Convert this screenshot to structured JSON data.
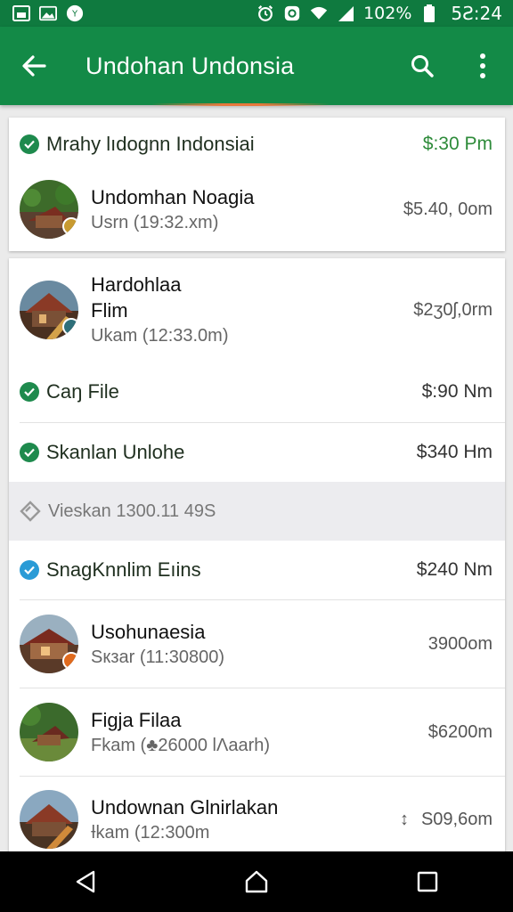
{
  "status_bar": {
    "battery": "102%",
    "time": "5Ƨ:24"
  },
  "app_bar": {
    "title": "Undohan Undonsia"
  },
  "card1": {
    "header": {
      "label": "Mrahy lıdognn Indonsiai",
      "value": "$:30 Pm"
    },
    "item": {
      "title": "Undomhan Noagia",
      "subtitle": "Usrn (19:32.xm)",
      "value": "$5.40, 0om"
    }
  },
  "card2": {
    "item1": {
      "title_line1": "Hardohlaa",
      "title_line2": "Flim",
      "subtitle": "Ukam (12:33.0m)",
      "value": "$2ʒ0ʃ,0rm"
    },
    "row_a": {
      "label": "Caŋ File",
      "value": "$:90 Nm"
    },
    "row_b": {
      "label": "Skanlan Unlohe",
      "value": "$340 Hm"
    },
    "section": {
      "label": "Vieskan 1300.11 49S"
    },
    "row_c": {
      "label": "SnagKnnlim Eıins",
      "value": "$240 Nm"
    },
    "item2": {
      "title": "Usohunaesia",
      "subtitle": "Sкзar (11:30800)",
      "value": "3900om"
    },
    "item3": {
      "title": "Figja Filaa",
      "subtitle": "Fkam (♣26000 lΛaarh)",
      "value": "$6200m"
    },
    "item4": {
      "title": "Undownan Glnirlakan",
      "subtitle": "Ɨkam (12:300m",
      "value": "S09,6om",
      "prefix": "↕"
    }
  },
  "colors": {
    "primary": "#138a47",
    "status": "#0f7a3f",
    "accent": "#e8783c",
    "check": "#1e8a4d",
    "check_blue": "#2a9bd6"
  }
}
